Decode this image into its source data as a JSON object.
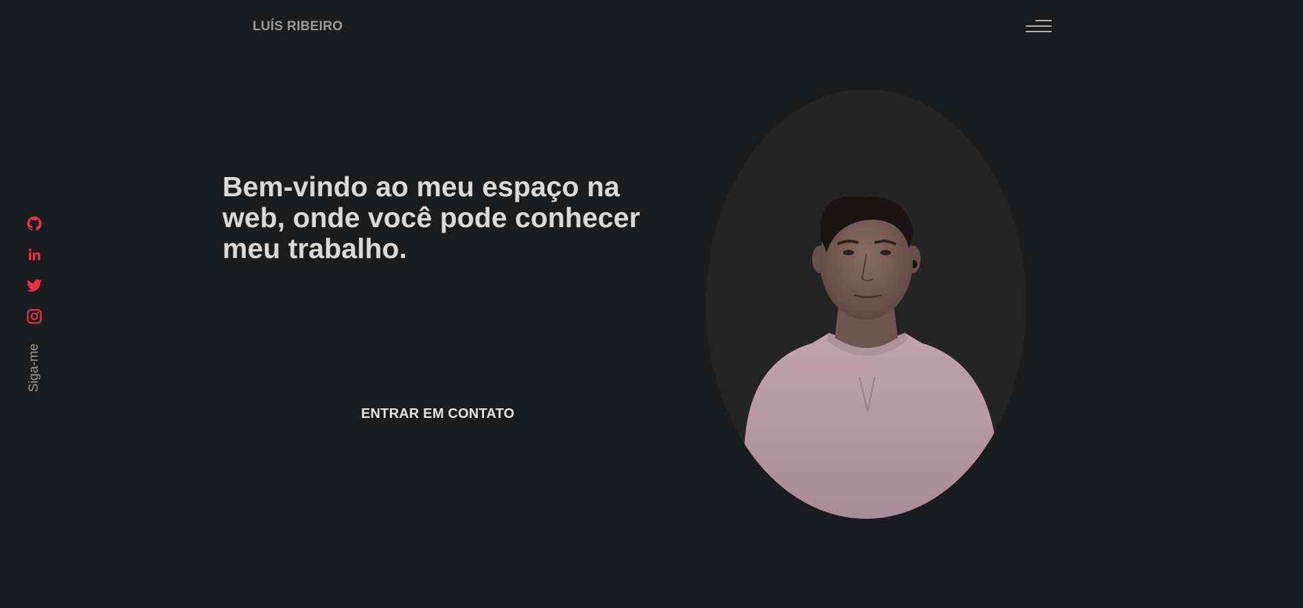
{
  "header": {
    "logo": "LUÍS RIBEIRO",
    "menu_icon": "hamburger-menu-icon"
  },
  "social": {
    "items": [
      {
        "name": "github",
        "icon": "github-icon"
      },
      {
        "name": "linkedin",
        "icon": "linkedin-icon"
      },
      {
        "name": "twitter",
        "icon": "twitter-icon"
      },
      {
        "name": "instagram",
        "icon": "instagram-icon"
      }
    ],
    "label": "Siga-me",
    "icon_color": "#e8324a"
  },
  "hero": {
    "title": "Bem-vindo ao meu espaço na web, onde você pode conhecer meu trabalho.",
    "cta_label": "ENTRAR EM CONTATO"
  },
  "colors": {
    "background": "#1b1c1e",
    "accent": "#e8324a",
    "portrait_bg": "#242424",
    "shirt": "#b99aa6"
  }
}
